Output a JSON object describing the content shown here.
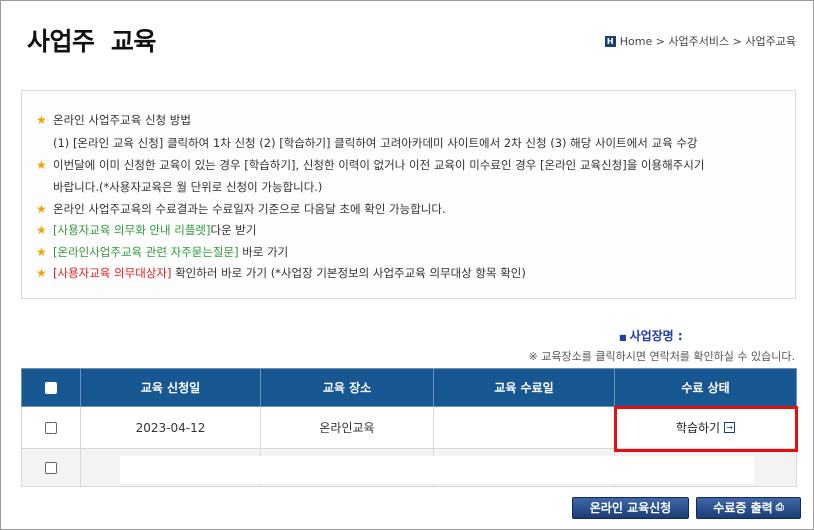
{
  "header": {
    "title": "사업주  교육",
    "breadcrumb": {
      "home_icon": "H",
      "home": "Home",
      "sep1": " > ",
      "level1": "사업주서비스",
      "sep2": " > ",
      "level2": "사업주교육"
    }
  },
  "notice": {
    "lines": [
      {
        "star": true,
        "text": "온라인 사업주교육 신청 방법"
      },
      {
        "star": false,
        "text": "(1) [온라인 교육 신청] 클릭하여 1차 신청 (2) [학습하기] 클릭하여 고려아카데미 사이트에서 2차 신청 (3) 해당 사이트에서 교육 수강"
      },
      {
        "star": true,
        "text": "이번달에 이미 신청한 교육이 있는 경우 [학습하기], 신청한 이력이 없거나 이전 교육이 미수료인 경우 [온라인 교육신청]을 이용해주시기"
      },
      {
        "star": false,
        "text": "바랍니다.(*사용자교육은 월 단위로 신청이 가능합니다.)"
      },
      {
        "star": true,
        "text": "온라인 사업주교육의 수료결과는 수료일자 기준으로 다음달 초에 확인 가능합니다."
      }
    ],
    "link1": {
      "link": "[사용자교육 의무화 안내 리플렛]",
      "rest": "다운 받기"
    },
    "link2": {
      "link": "[온라인사업주교육 관련 자주묻는질문]",
      "rest": " 바로 가기"
    },
    "link3": {
      "link": "[사용자교육 의무대상자]",
      "rest": " 확인하러 바로 가기 (*사업장 기본정보의 사업주교육 의무대상 항목 확인)"
    }
  },
  "business": {
    "marker": "■",
    "label": "사업장명 :",
    "hint": "※ 교육장소를 클릭하시면 연락처를 확인하실 수 있습니다."
  },
  "table": {
    "headers": [
      "교육 신청일",
      "교육 장소",
      "교육 수료일",
      "수료 상태"
    ],
    "rows": [
      {
        "date": "2023-04-12",
        "place": "온라인교육",
        "completed": "",
        "status": "학습하기",
        "status_icon": "→"
      }
    ]
  },
  "buttons": {
    "apply": "온라인 교육신청",
    "certificate": "수료증 출력",
    "print_icon": "⎙"
  },
  "colors": {
    "header_bg": "#175892",
    "accent_blue": "#1c3ea8",
    "star": "#f2a20c",
    "green_link": "#2f9a3a",
    "red_link": "#e02020",
    "highlight": "#e50f0f"
  }
}
